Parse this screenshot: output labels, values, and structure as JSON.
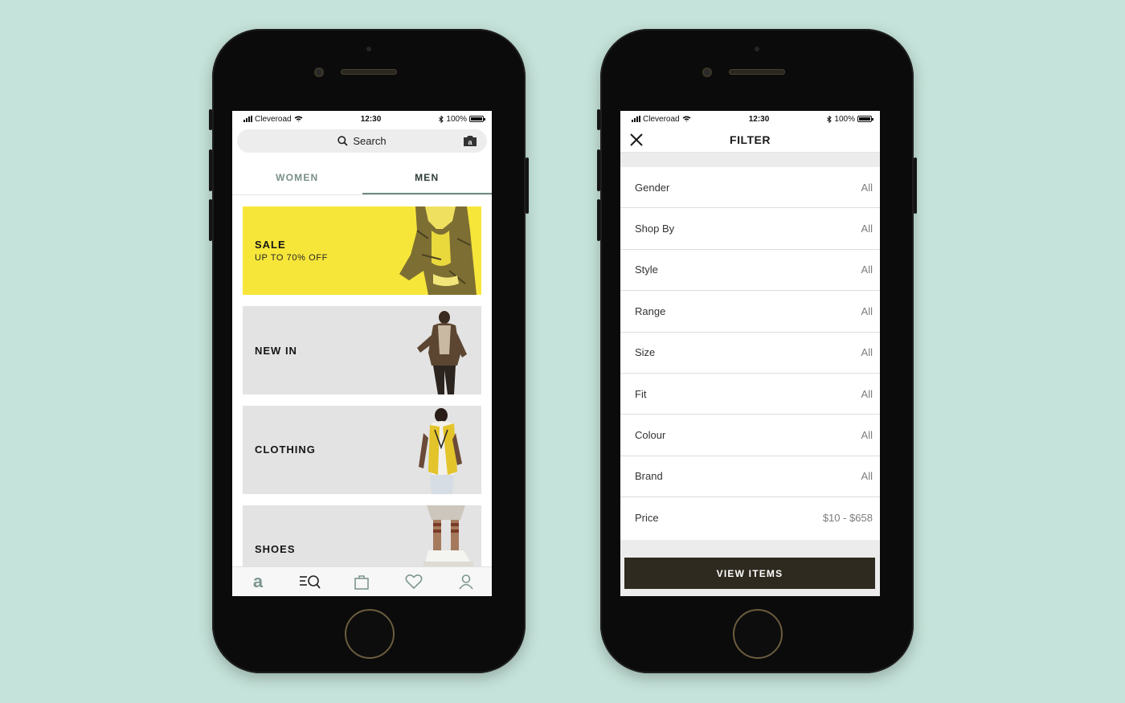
{
  "left_screen": {
    "status": {
      "carrier": "Cleveroad",
      "time": "12:30",
      "battery": "100%",
      "battery_level": 1.0
    },
    "search": {
      "placeholder": "Search"
    },
    "tabs": [
      {
        "label": "WOMEN",
        "active": false
      },
      {
        "label": "MEN",
        "active": true
      }
    ],
    "cards": [
      {
        "title": "SALE",
        "subtitle": "UP TO 70% OFF",
        "color": "#f7e63a"
      },
      {
        "title": "NEW IN",
        "subtitle": "",
        "color": "#e3e3e3"
      },
      {
        "title": "CLOTHING",
        "subtitle": "",
        "color": "#e3e3e3"
      },
      {
        "title": "SHOES",
        "subtitle": "",
        "color": "#e3e3e3"
      }
    ],
    "bottom_nav": [
      "home-logo-icon",
      "search-categories-icon",
      "bag-icon",
      "heart-icon",
      "profile-icon"
    ]
  },
  "right_screen": {
    "status": {
      "carrier": "Cleveroad",
      "time": "12:30",
      "battery": "100%",
      "battery_level": 1.0
    },
    "title": "FILTER",
    "filters": [
      {
        "label": "Gender",
        "value": "All"
      },
      {
        "label": "Shop By",
        "value": "All"
      },
      {
        "label": "Style",
        "value": "All"
      },
      {
        "label": "Range",
        "value": "All"
      },
      {
        "label": "Size",
        "value": "All"
      },
      {
        "label": "Fit",
        "value": "All"
      },
      {
        "label": "Colour",
        "value": "All"
      },
      {
        "label": "Brand",
        "value": "All"
      },
      {
        "label": "Price",
        "value": "$10 - $658"
      }
    ],
    "button_label": "VIEW ITEMS"
  },
  "colors": {
    "background": "#c5e3da",
    "sale_yellow": "#f7e63a",
    "accent_teal": "#6f8c84",
    "button_dark": "#2f2a1f"
  }
}
